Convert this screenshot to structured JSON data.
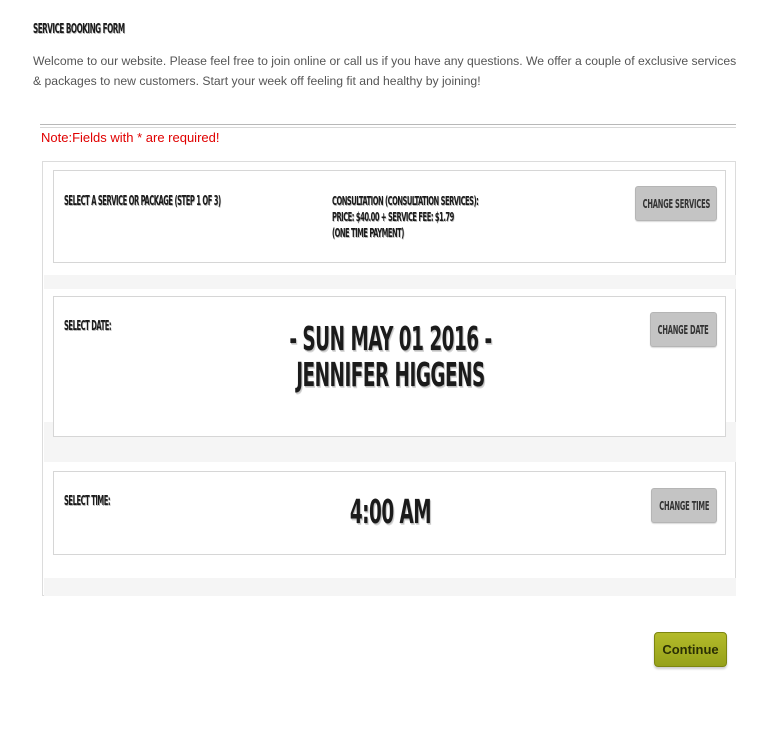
{
  "page": {
    "title": "SERVICE BOOKING FORM",
    "intro": "Welcome to our website. Please feel free to join online or call us if you have any questions. We offer a couple of exclusive services & packages to new customers. Start your week off feeling fit and healthy by joining!",
    "required_note": "Note:Fields with * are required!"
  },
  "service": {
    "label": "SELECT A SERVICE OR PACKAGE (STEP 1 OF 3)",
    "name": "CONSULTATION (CONSULTATION SERVICES):",
    "price": "PRICE: $40.00 + SERVICE FEE: $1.79",
    "payment": "(ONE TIME PAYMENT)",
    "button": "CHANGE SERVICES"
  },
  "date": {
    "label": "SELECT DATE:",
    "value": "- SUN MAY 01 2016 -",
    "staff": "JENNIFER HIGGENS",
    "button": "CHANGE DATE"
  },
  "time": {
    "label": "SELECT TIME:",
    "value": "4:00 AM",
    "button": "CHANGE TIME"
  },
  "actions": {
    "continue": "Continue"
  },
  "colors": {
    "note": "#e00000",
    "continue_button": "#a5ae22",
    "secondary_button": "#c4c4c4"
  }
}
